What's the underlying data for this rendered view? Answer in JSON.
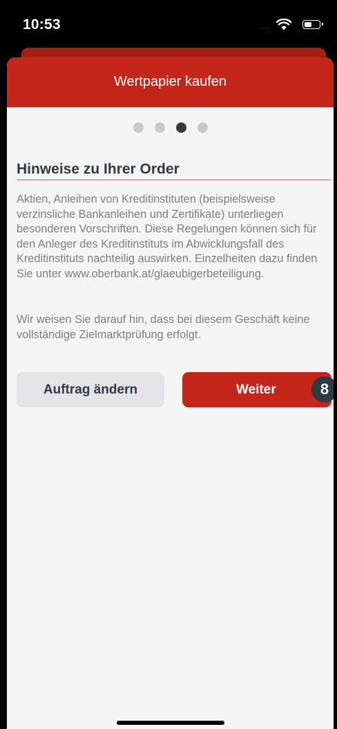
{
  "status": {
    "time": "10:53",
    "signal": "....",
    "wifi_icon": "wifi-icon",
    "battery_icon": "battery-icon"
  },
  "nav": {
    "title": "Wertpapier kaufen"
  },
  "pager": {
    "total": 4,
    "current": 3
  },
  "section": {
    "title": "Hinweise zu Ihrer Order",
    "paragraph1": "Aktien, Anleihen von Kreditinstituten (beispielsweise verzinsliche Bankanleihen und Zertifikate) unterliegen besonderen Vorschriften. Diese Regelungen können sich für den Anleger des Kreditinstituts im Abwicklungsfall des Kreditinstituts nachteilig auswirken. Einzelheiten dazu finden Sie unter www.oberbank.at/glaeubigerbeteiligung.",
    "paragraph2": "Wir weisen Sie darauf hin, dass bei diesem Geschäft keine vollständige Zielmarktprüfung erfolgt."
  },
  "actions": {
    "secondary_label": "Auftrag ändern",
    "primary_label": "Weiter",
    "badge": "8"
  },
  "colors": {
    "brand_red": "#c4261a",
    "dark": "#2f3b44",
    "background": "#f5f5f5"
  }
}
